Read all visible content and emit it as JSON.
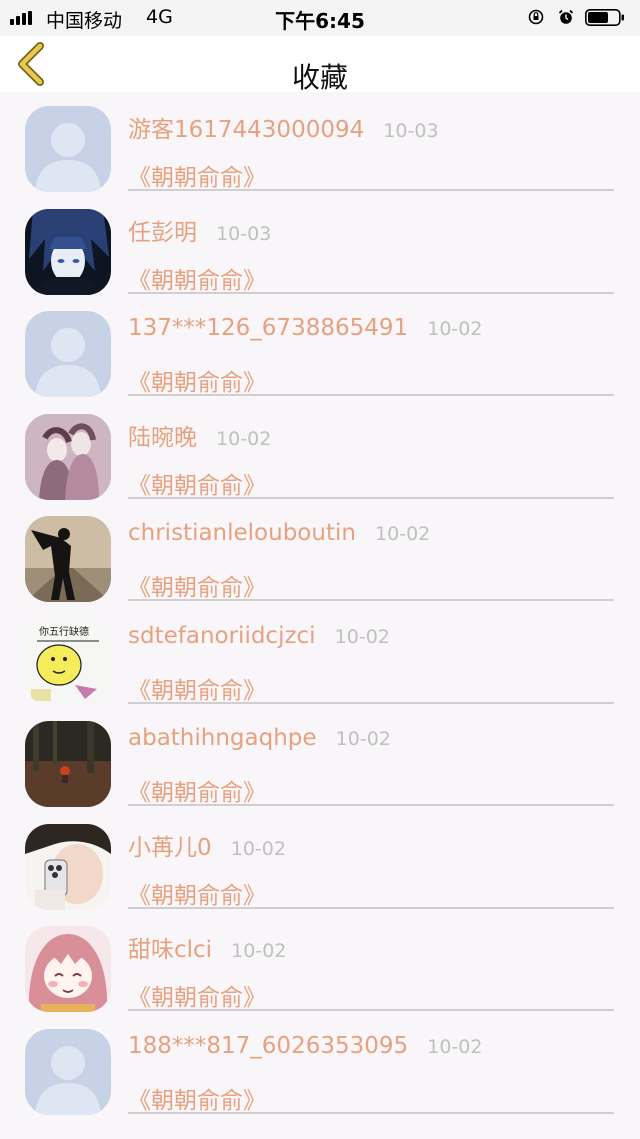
{
  "status_bar": {
    "carrier": "中国移动",
    "network": "4G",
    "time": "下午6:45"
  },
  "nav": {
    "title": "收藏",
    "back_icon": "chevron-left-icon"
  },
  "colors": {
    "accent": "#e6a280",
    "date": "#c0c0c0",
    "back_icon": "#e8c94f"
  },
  "items": [
    {
      "name": "游客1617443000094",
      "date": "10-03",
      "title": "《朝朝俞俞》",
      "avatar": "default"
    },
    {
      "name": "任彭明",
      "date": "10-03",
      "title": "《朝朝俞俞》",
      "avatar": "anime-boy"
    },
    {
      "name": "137***126_6738865491",
      "date": "10-02",
      "title": "《朝朝俞俞》",
      "avatar": "default"
    },
    {
      "name": "陆晼晚",
      "date": "10-02",
      "title": "《朝朝俞俞》",
      "avatar": "anime-couple"
    },
    {
      "name": "christianlelouboutin",
      "date": "10-02",
      "title": "《朝朝俞俞》",
      "avatar": "silhouette"
    },
    {
      "name": "sdtefanoriidcjzci",
      "date": "10-02",
      "title": "《朝朝俞俞》",
      "avatar": "meme"
    },
    {
      "name": "abathihngaqhpe",
      "date": "10-02",
      "title": "《朝朝俞俞》",
      "avatar": "forest"
    },
    {
      "name": "小苒儿0",
      "date": "10-02",
      "title": "《朝朝俞俞》",
      "avatar": "selfie"
    },
    {
      "name": "甜味clci",
      "date": "10-02",
      "title": "《朝朝俞俞》",
      "avatar": "anime-girl"
    },
    {
      "name": "188***817_6026353095",
      "date": "10-02",
      "title": "《朝朝俞俞》",
      "avatar": "default"
    }
  ]
}
